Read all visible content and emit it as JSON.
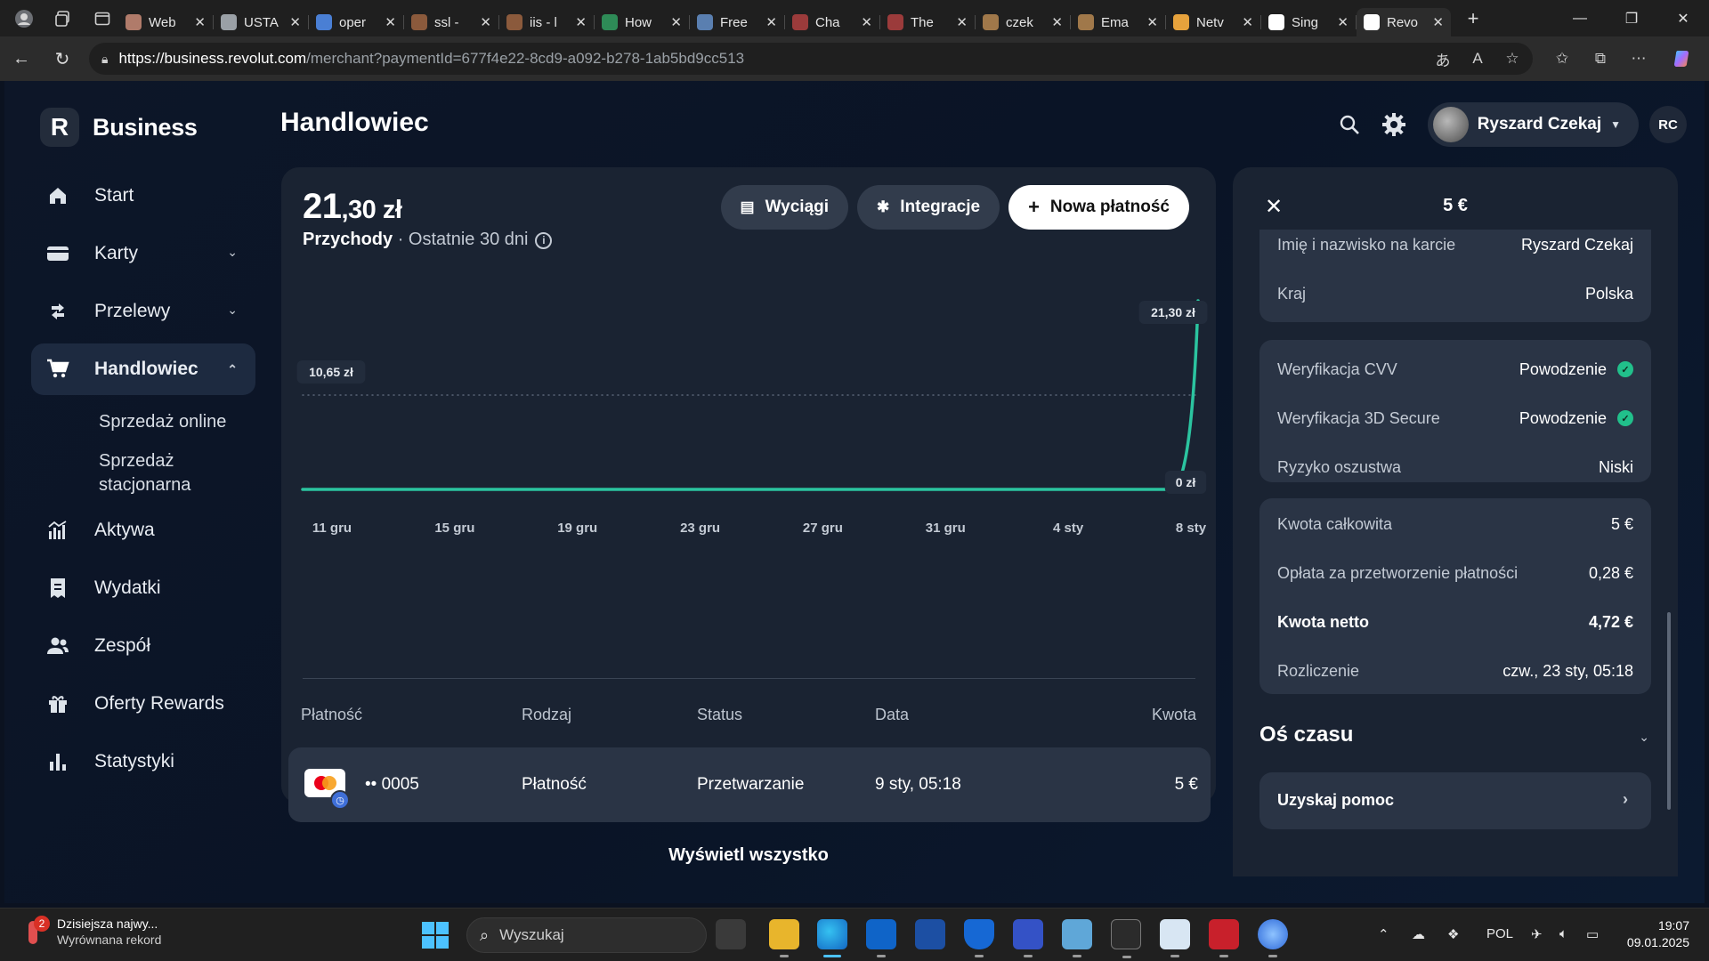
{
  "browser": {
    "tabs": [
      {
        "label": "Web",
        "color": "#b07b6a"
      },
      {
        "label": "USTA",
        "color": "#9aa0a6"
      },
      {
        "label": "oper",
        "color": "#4a7fd4"
      },
      {
        "label": "ssl -",
        "color": "#8b5a3c"
      },
      {
        "label": "iis - l",
        "color": "#8b5a3c"
      },
      {
        "label": "How",
        "color": "#2e8b57"
      },
      {
        "label": "Free",
        "color": "#5a7fb0"
      },
      {
        "label": "Cha",
        "color": "#9b3b3b"
      },
      {
        "label": "The",
        "color": "#9b3b3b"
      },
      {
        "label": "czek",
        "color": "#a0784a"
      },
      {
        "label": "Ema",
        "color": "#a0784a"
      },
      {
        "label": "Netv",
        "color": "#e6a23c"
      },
      {
        "label": "Sing",
        "color": "#ffffff"
      },
      {
        "label": "Revo",
        "color": "#ffffff"
      }
    ],
    "url_host": "https://business.revolut.com",
    "url_path": "/merchant?paymentId=677f4e22-8cd9-a092-b278-1ab5bd9cc513"
  },
  "sidebar": {
    "logo_text": "Business",
    "items": [
      {
        "label": "Start",
        "icon": "home-icon"
      },
      {
        "label": "Karty",
        "icon": "card-icon"
      },
      {
        "label": "Przelewy",
        "icon": "transfer-icon"
      },
      {
        "label": "Handlowiec",
        "icon": "cart-icon"
      },
      {
        "label": "Aktywa",
        "icon": "assets-icon"
      },
      {
        "label": "Wydatki",
        "icon": "expenses-icon"
      },
      {
        "label": "Zespół",
        "icon": "team-icon"
      },
      {
        "label": "Oferty Rewards",
        "icon": "gift-icon"
      },
      {
        "label": "Statystyki",
        "icon": "stats-icon"
      }
    ],
    "sub_items": [
      "Sprzedaż online",
      "Sprzedaż stacjonarna"
    ]
  },
  "header": {
    "title": "Handlowiec",
    "user_name": "Ryszard Czekaj",
    "initials": "RC"
  },
  "summary": {
    "amount_int": "21",
    "amount_dec": ",30 zł",
    "label_bold": "Przychody",
    "label_rest": " · Ostatnie 30 dni",
    "buttons": {
      "statements": "Wyciągi",
      "integrations": "Integracje",
      "new_payment": "Nowa płatność"
    }
  },
  "chart_data": {
    "type": "line",
    "categories": [
      "11 gru",
      "15 gru",
      "19 gru",
      "23 gru",
      "27 gru",
      "31 gru",
      "4 sty",
      "8 sty"
    ],
    "x": [
      "10 gru",
      "9 sty"
    ],
    "series": [
      {
        "values": [
          0,
          0,
          0,
          0,
          0,
          0,
          0,
          0,
          0,
          0,
          0,
          0,
          0,
          0,
          0,
          0,
          0,
          0,
          0,
          0,
          0,
          0,
          0,
          0,
          0,
          0,
          0,
          0,
          0,
          0,
          21.3
        ]
      }
    ],
    "labels": {
      "max": "21,30 zł",
      "mid": "10,65 zł",
      "min": "0 zł"
    },
    "ylim": [
      0,
      21.3
    ],
    "line_color": "#2bc4a0",
    "grid": "dotted line at midpoint"
  },
  "table": {
    "headers": [
      "Płatność",
      "Rodzaj",
      "Status",
      "Data",
      "Kwota"
    ],
    "rows": [
      {
        "card": "•• 0005",
        "type": "Płatność",
        "status": "Przetwarzanie",
        "date": "9 sty, 05:18",
        "amount": "5 €"
      }
    ],
    "view_all": "Wyświetl wszystko"
  },
  "details": {
    "title": "5 €",
    "group1": [
      {
        "k": "Imię i nazwisko na karcie",
        "v": "Ryszard Czekaj"
      },
      {
        "k": "Kraj",
        "v": "Polska"
      }
    ],
    "group2": [
      {
        "k": "Weryfikacja CVV",
        "v": "Powodzenie"
      },
      {
        "k": "Weryfikacja 3D Secure",
        "v": "Powodzenie"
      },
      {
        "k": "Ryzyko oszustwa",
        "v": "Niski"
      }
    ],
    "group3": [
      {
        "k": "Kwota całkowita",
        "v": "5 €"
      },
      {
        "k": "Opłata za przetworzenie płatności",
        "v": "0,28 €"
      },
      {
        "k": "Kwota netto",
        "v": "4,72 €"
      },
      {
        "k": "Rozliczenie",
        "v": "czw., 23 sty, 05:18"
      }
    ],
    "timeline": "Oś czasu",
    "help": "Uzyskaj pomoc"
  },
  "taskbar": {
    "weather_line1": "Dzisiejsza najwy...",
    "weather_line2": "Wyrównana rekord",
    "weather_badge": "2",
    "search_placeholder": "Wyszukaj",
    "lang": "POL",
    "time": "19:07",
    "date": "09.01.2025"
  }
}
